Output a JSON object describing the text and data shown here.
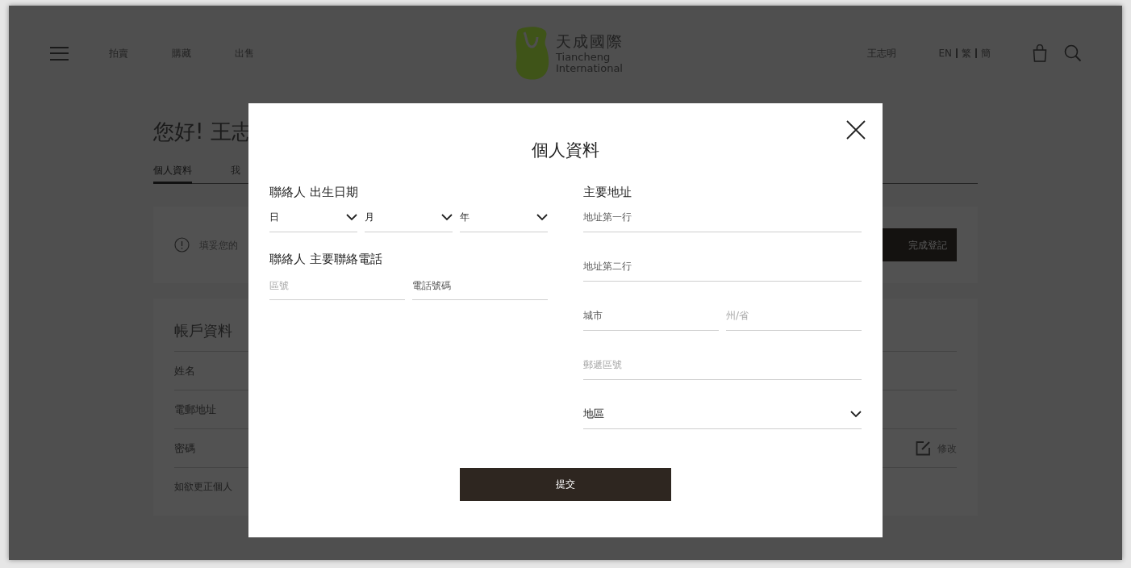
{
  "header": {
    "nav": [
      "拍賣",
      "購藏",
      "出售"
    ],
    "logo": {
      "name_zh": "天成國際",
      "name_en_1": "Tiancheng",
      "name_en_2": "International"
    },
    "user": "王志明",
    "languages": [
      "EN",
      "繁",
      "簡"
    ]
  },
  "profile": {
    "greeting": "您好! 王志",
    "tabs": [
      {
        "label": "個人資料",
        "selected": true
      },
      {
        "label": "我",
        "selected": false
      }
    ],
    "notice": "填妥您的",
    "complete_button": "完成登記",
    "account": {
      "title": "帳戶資料",
      "rows": [
        {
          "label": "姓名"
        },
        {
          "label": "電郵地址"
        },
        {
          "label": "密碼",
          "action": "修改"
        }
      ],
      "footer": "如欲更正個人"
    }
  },
  "modal": {
    "title": "個人資料",
    "birth_date": {
      "label": "聯絡人 出生日期",
      "selects": [
        "日",
        "月",
        "年"
      ]
    },
    "phone": {
      "label": "聯絡人 主要聯絡電話",
      "fields": [
        {
          "placeholder": "區號",
          "required": false
        },
        {
          "placeholder": "電話號碼",
          "required": true
        }
      ]
    },
    "address": {
      "label": "主要地址",
      "rows": [
        [
          {
            "kind": "text",
            "placeholder": "地址第一行",
            "required": true
          }
        ],
        [
          {
            "kind": "text",
            "placeholder": "地址第二行",
            "required": true
          }
        ],
        [
          {
            "kind": "text",
            "placeholder": "城市",
            "required": true
          },
          {
            "kind": "text",
            "placeholder": "州/省",
            "required": false
          }
        ],
        [
          {
            "kind": "text",
            "placeholder": "郵遞區號",
            "required": false
          }
        ],
        [
          {
            "kind": "select",
            "label": "地區"
          }
        ]
      ]
    },
    "submit": "提交"
  }
}
